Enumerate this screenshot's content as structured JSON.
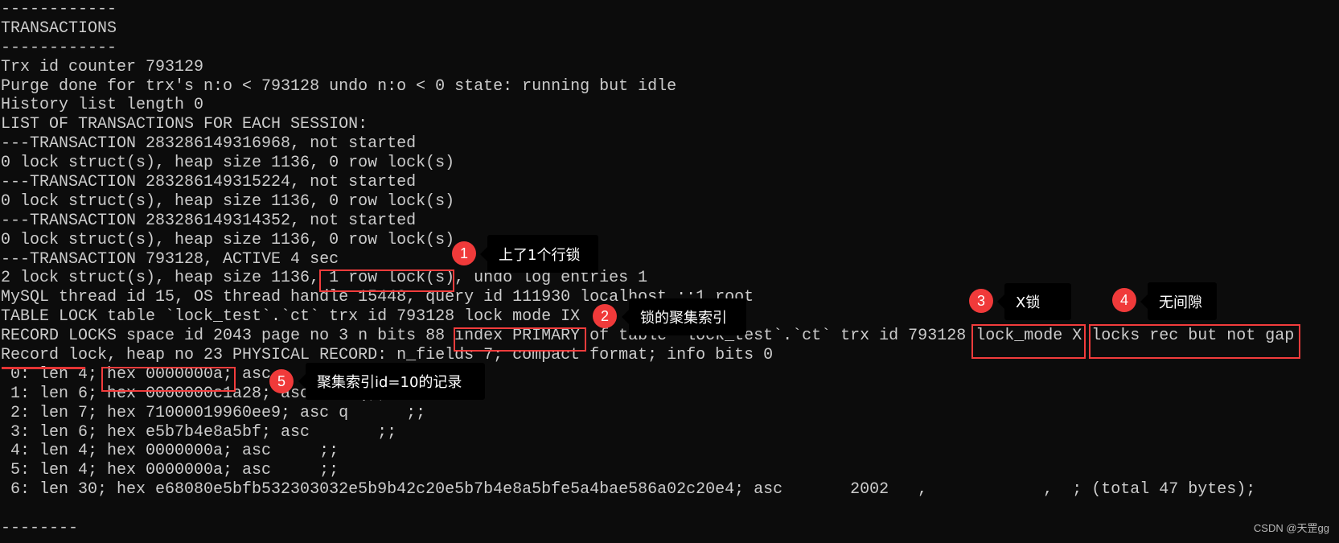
{
  "console": {
    "lines": [
      "------------",
      "TRANSACTIONS",
      "------------",
      "Trx id counter 793129",
      "Purge done for trx's n:o < 793128 undo n:o < 0 state: running but idle",
      "History list length 0",
      "LIST OF TRANSACTIONS FOR EACH SESSION:",
      "---TRANSACTION 283286149316968, not started",
      "0 lock struct(s), heap size 1136, 0 row lock(s)",
      "---TRANSACTION 283286149315224, not started",
      "0 lock struct(s), heap size 1136, 0 row lock(s)",
      "---TRANSACTION 283286149314352, not started",
      "0 lock struct(s), heap size 1136, 0 row lock(s)",
      "---TRANSACTION 793128, ACTIVE 4 sec",
      "2 lock struct(s), heap size 1136, 1 row lock(s), undo log entries 1",
      "MySQL thread id 15, OS thread handle 15448, query id 111930 localhost ::1 root",
      "TABLE LOCK table `lock_test`.`ct` trx id 793128 lock mode IX",
      "RECORD LOCKS space id 2043 page no 3 n bits 88 index PRIMARY of table `lock_test`.`ct` trx id 793128 lock_mode X locks rec but not gap",
      "Record lock, heap no 23 PHYSICAL RECORD: n_fields 7; compact format; info bits 0",
      " 0: len 4; hex 0000000a; asc     ;;",
      " 1: len 6; hex 0000000c1a28; asc     (;;",
      " 2: len 7; hex 71000019960ee9; asc q      ;;",
      " 3: len 6; hex e5b7b4e8a5bf; asc       ;;",
      " 4: len 4; hex 0000000a; asc     ;;",
      " 5: len 4; hex 0000000a; asc     ;;",
      " 6: len 30; hex e68080e5bfb532303032e5b9b42c20e5b7b4e8a5bfe5a4bae586a02c20e4; asc       2002   ,            ,  ; (total 47 bytes);",
      "",
      "--------"
    ]
  },
  "annotations": [
    {
      "number": "1",
      "label": "上了1个行锁",
      "target": "1 row lock(s)"
    },
    {
      "number": "2",
      "label": "锁的聚集索引",
      "target": "index PRIMARY"
    },
    {
      "number": "3",
      "label": "X锁",
      "target": "lock_mode X"
    },
    {
      "number": "4",
      "label": "无间隙",
      "target": "locks rec but not gap"
    },
    {
      "number": "5",
      "label": "聚集索引id=10的记录",
      "target": "hex 0000000a;"
    }
  ],
  "colors": {
    "background": "#0c0c0c",
    "text": "#cccccc",
    "highlight": "#f33c3c",
    "badge": "#f03a3a",
    "tooltip": "#000000"
  },
  "watermark": "CSDN @天罡gg"
}
